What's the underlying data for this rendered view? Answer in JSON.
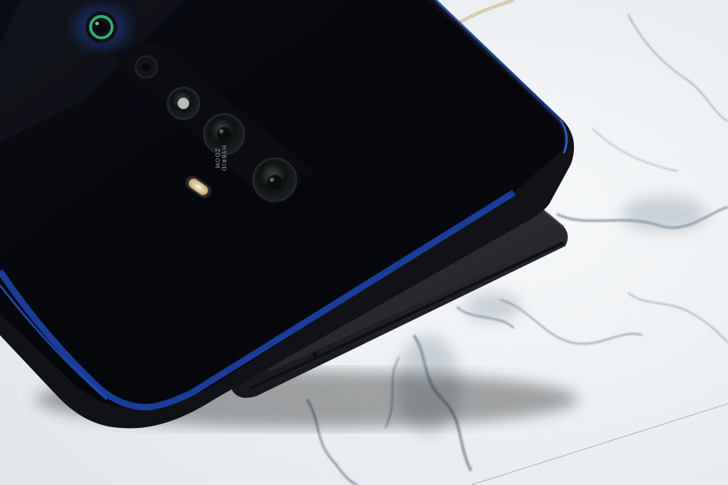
{
  "image": {
    "subject": "smartphone-with-pop-up-selfie-camera-on-marble",
    "colors": {
      "marble_base": "#eef1f3",
      "marble_vein": "#5f7282",
      "phone_body": "#06070c",
      "frame_blue": "#1d47b3",
      "popup_module": "#1e1f24",
      "lens_ring_green": "#2fb176"
    }
  },
  "camera_engraving": {
    "line1": "HYBRID",
    "line2": "ZOOM"
  }
}
